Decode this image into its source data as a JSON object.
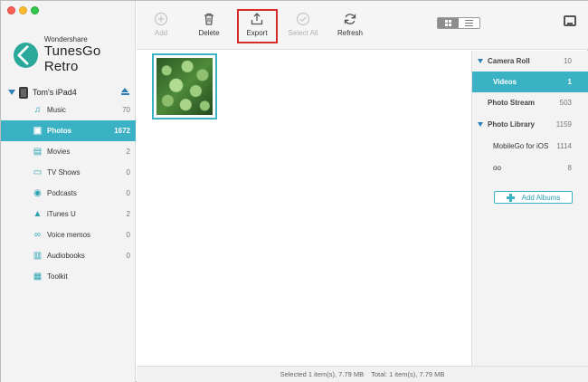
{
  "brand": {
    "vendor": "Wondershare",
    "product": "TunesGo Retro"
  },
  "device": {
    "name": "Tom's iPad4"
  },
  "sidebar": {
    "items": [
      {
        "label": "Music",
        "count": "70",
        "icon": "music-icon"
      },
      {
        "label": "Photos",
        "count": "1672",
        "icon": "photos-icon",
        "active": true
      },
      {
        "label": "Movies",
        "count": "2",
        "icon": "movies-icon"
      },
      {
        "label": "TV Shows",
        "count": "0",
        "icon": "tv-icon"
      },
      {
        "label": "Podcasts",
        "count": "0",
        "icon": "podcast-icon"
      },
      {
        "label": "iTunes U",
        "count": "2",
        "icon": "itunes-u-icon"
      },
      {
        "label": "Voice memos",
        "count": "0",
        "icon": "voicemail-icon"
      },
      {
        "label": "Audiobooks",
        "count": "0",
        "icon": "book-icon"
      },
      {
        "label": "Toolkit",
        "count": "",
        "icon": "toolkit-icon"
      }
    ]
  },
  "toolbar": {
    "add": "Add",
    "delete": "Delete",
    "export": "Export",
    "select_all": "Select All",
    "refresh": "Refresh"
  },
  "albums": {
    "items": [
      {
        "label": "Camera Roll",
        "count": "10",
        "group": true
      },
      {
        "label": "Videos",
        "count": "1",
        "active": true
      },
      {
        "label": "Photo Stream",
        "count": "503"
      },
      {
        "label": "Photo Library",
        "count": "1159",
        "group": true
      },
      {
        "label": "MobileGo for iOS",
        "count": "1114"
      },
      {
        "label": "oo",
        "count": "8"
      }
    ],
    "add_albums": "Add Albums"
  },
  "status": {
    "selected": "Selected 1 item(s), 7.79 MB",
    "total": "Total: 1 item(s), 7.79 MB"
  },
  "colors": {
    "accent": "#3bb1c4",
    "export_highlight": "#d52b2b"
  }
}
